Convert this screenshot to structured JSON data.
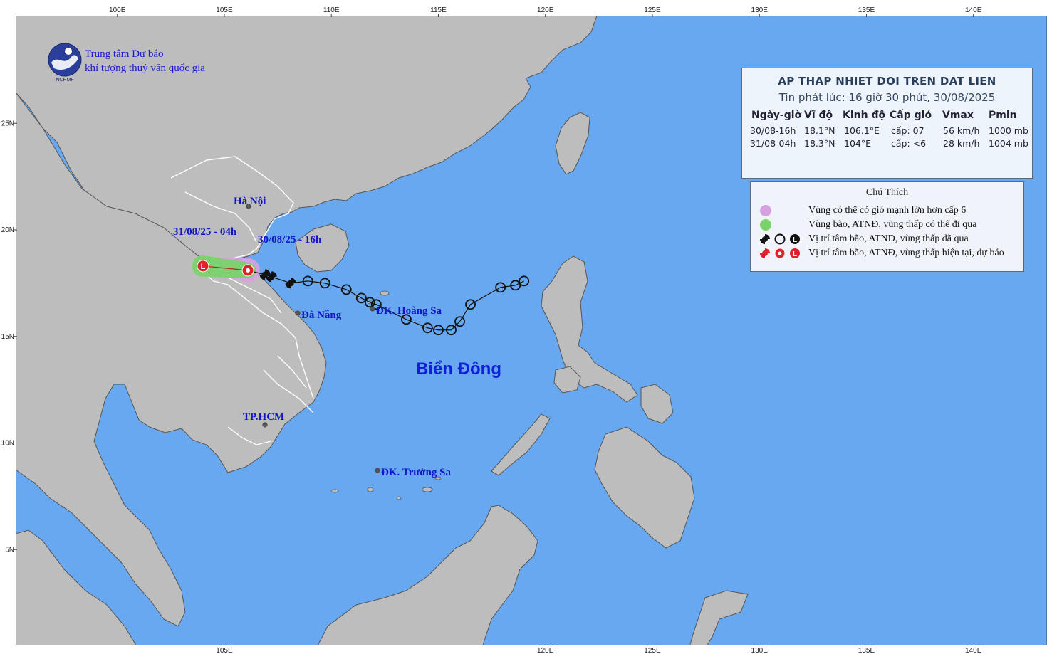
{
  "org": {
    "line1": "Trung tâm Dự báo",
    "line2": "khí tượng thuỷ văn quốc gia",
    "logo_text": "NCHMF"
  },
  "axes": {
    "top_labels": [
      "100E",
      "105E",
      "110E",
      "115E",
      "120E",
      "125E",
      "130E",
      "135E",
      "140E"
    ],
    "bottom_labels": [
      "105E",
      "120E",
      "125E",
      "130E",
      "135E",
      "140E"
    ],
    "left_labels": [
      "25N",
      "20N",
      "15N",
      "10N",
      "5N"
    ]
  },
  "places": {
    "ha_noi": "Hà Nội",
    "da_nang": "Đà Nẵng",
    "hoang_sa": "ĐK. Hoàng Sa",
    "tphcm": "TP.HCM",
    "truong_sa": "ĐK. Trường Sa",
    "sea": "Biển Đông"
  },
  "track_labels": {
    "forecast": "31/08/25 - 04h",
    "current": "30/08/25 - 16h"
  },
  "info": {
    "title": "AP THAP NHIET DOI TREN DAT LIEN",
    "subtitle": "Tin phát lúc: 16 giờ 30 phút, 30/08/2025",
    "headers": [
      "Ngày-giờ",
      "Vĩ độ",
      "Kinh độ",
      "Cấp gió",
      "Vmax",
      "Pmin"
    ],
    "rows": [
      [
        "30/08-16h",
        "18.1°N",
        "106.1°E",
        "cấp: 07",
        "56 km/h",
        "1000 mb"
      ],
      [
        "31/08-04h",
        "18.3°N",
        "104°E",
        "cấp: <6",
        "28 km/h",
        "1004 mb"
      ]
    ]
  },
  "legend": {
    "title": "Chú Thích",
    "items": [
      "Vùng có thể có gió mạnh lớn hơn cấp 6",
      "Vùng bão, ATNĐ, vùng thấp có thể đi qua",
      "Vị trí tâm bão, ATNĐ, vùng thấp đã qua",
      "Vị trí tâm bão, ATNĐ, vùng thấp hiện tại, dự báo"
    ]
  },
  "storm": {
    "past_track": [
      [
        119.0,
        17.6
      ],
      [
        118.6,
        17.4
      ],
      [
        117.9,
        17.3
      ],
      [
        116.5,
        16.5
      ],
      [
        116.0,
        15.7
      ],
      [
        115.6,
        15.3
      ],
      [
        115.0,
        15.3
      ],
      [
        114.5,
        15.4
      ],
      [
        113.5,
        15.8
      ],
      [
        112.1,
        16.5
      ],
      [
        111.8,
        16.6
      ],
      [
        111.4,
        16.8
      ],
      [
        110.7,
        17.2
      ],
      [
        109.7,
        17.5
      ],
      [
        108.9,
        17.6
      ],
      [
        108.1,
        17.5
      ],
      [
        107.2,
        17.8
      ],
      [
        106.9,
        17.9
      ]
    ],
    "current": [
      106.1,
      18.1
    ],
    "forecast": [
      104.0,
      18.3
    ]
  }
}
